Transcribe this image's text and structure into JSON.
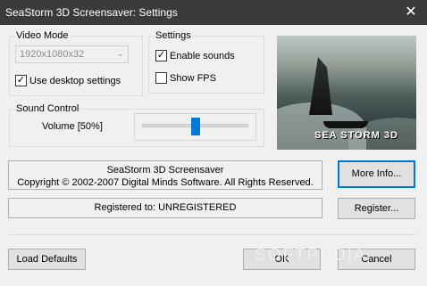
{
  "window": {
    "title": "SeaStorm 3D Screensaver: Settings",
    "close_glyph": "✕"
  },
  "video_mode": {
    "group_label": "Video Mode",
    "resolution_value": "1920x1080x32",
    "use_desktop_label": "Use desktop settings",
    "use_desktop_checked": true
  },
  "settings": {
    "group_label": "Settings",
    "enable_sounds_label": "Enable sounds",
    "enable_sounds_checked": true,
    "show_fps_label": "Show FPS",
    "show_fps_checked": false
  },
  "sound_control": {
    "group_label": "Sound Control",
    "volume_label": "Volume [50%]",
    "volume_fraction": 0.5
  },
  "preview": {
    "brand_text": "SEA STORM 3D"
  },
  "info": {
    "app_name": "SeaStorm 3D Screensaver",
    "copyright": "Copyright © 2002-2007 Digital Minds Software. All Rights Reserved.",
    "registration": "Registered to: UNREGISTERED"
  },
  "buttons": {
    "more_info": "More Info...",
    "register": "Register...",
    "load_defaults": "Load Defaults",
    "ok": "OK",
    "cancel": "Cancel"
  },
  "watermark": "SOFTPEDIA",
  "colors": {
    "titlebar": "#3b3b3b",
    "accent": "#0078d7"
  }
}
